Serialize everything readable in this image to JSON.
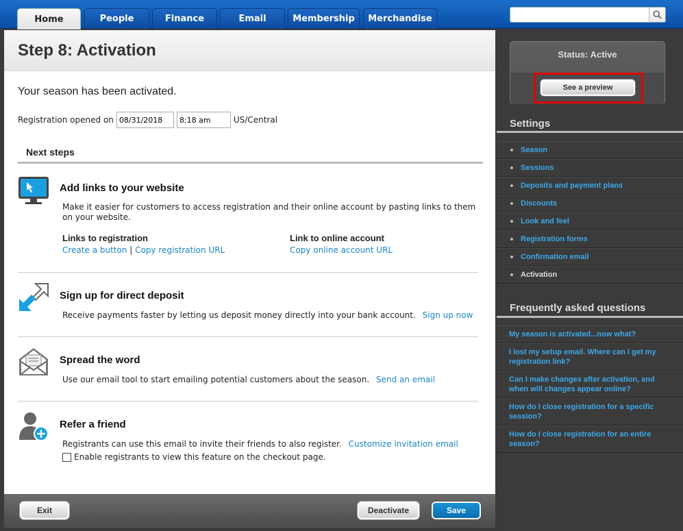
{
  "nav": {
    "tabs": [
      {
        "label": "Home"
      },
      {
        "label": "People"
      },
      {
        "label": "Finance"
      },
      {
        "label": "Email"
      },
      {
        "label": "Membership"
      },
      {
        "label": "Merchandise"
      }
    ],
    "search_value": ""
  },
  "main": {
    "title": "Step 8: Activation",
    "activated_message": "Your season has been activated.",
    "registration": {
      "label": "Registration opened on",
      "date": "08/31/2018",
      "time": "8:18 am",
      "timezone": "US/Central"
    },
    "next_steps_heading": "Next steps",
    "steps": {
      "links": {
        "title": "Add links to your website",
        "description": "Make it easier for customers to access registration and their online account by pasting links to them on your website.",
        "registration_heading": "Links to registration",
        "create_button_link": "Create a button",
        "separator": "|",
        "copy_registration_link": "Copy registration URL",
        "account_heading": "Link to online account",
        "copy_account_link": "Copy online account URL"
      },
      "deposit": {
        "title": "Sign up for direct deposit",
        "description": "Receive payments faster by letting us deposit money directly into your bank account.",
        "link": "Sign up now"
      },
      "spread": {
        "title": "Spread the word",
        "description": "Use our email tool to start emailing potential customers about the season.",
        "link": "Send an email"
      },
      "refer": {
        "title": "Refer a friend",
        "description": "Registrants can use this email to invite their friends to also register.",
        "link": "Customize invitation email",
        "checkbox_label": "Enable registrants to view this feature on the checkout page.",
        "checkbox_checked": false
      }
    }
  },
  "footer": {
    "exit_label": "Exit",
    "deactivate_label": "Deactivate",
    "save_label": "Save"
  },
  "sidebar": {
    "status": "Status: Active",
    "preview_label": "See a preview",
    "settings_heading": "Settings",
    "settings_items": [
      {
        "label": "Season"
      },
      {
        "label": "Sessions"
      },
      {
        "label": "Deposits and payment plans"
      },
      {
        "label": "Discounts"
      },
      {
        "label": "Look and feel"
      },
      {
        "label": "Registration forms"
      },
      {
        "label": "Confirmation email"
      },
      {
        "label": "Activation"
      }
    ],
    "faq_heading": "Frequently asked questions",
    "faq_items": [
      {
        "label": "My season is activated...now what?"
      },
      {
        "label": "I lost my setup email. Where can I get my registration link?"
      },
      {
        "label": "Can I make changes after activation, and when will changes appear online?"
      },
      {
        "label": "How do I close registration for a specific session?"
      },
      {
        "label": "How do I close registration for an entire season?"
      }
    ]
  },
  "colors": {
    "brand_blue": "#0a4fa8",
    "link_blue": "#1a86c8",
    "highlight_red": "#e00000"
  }
}
